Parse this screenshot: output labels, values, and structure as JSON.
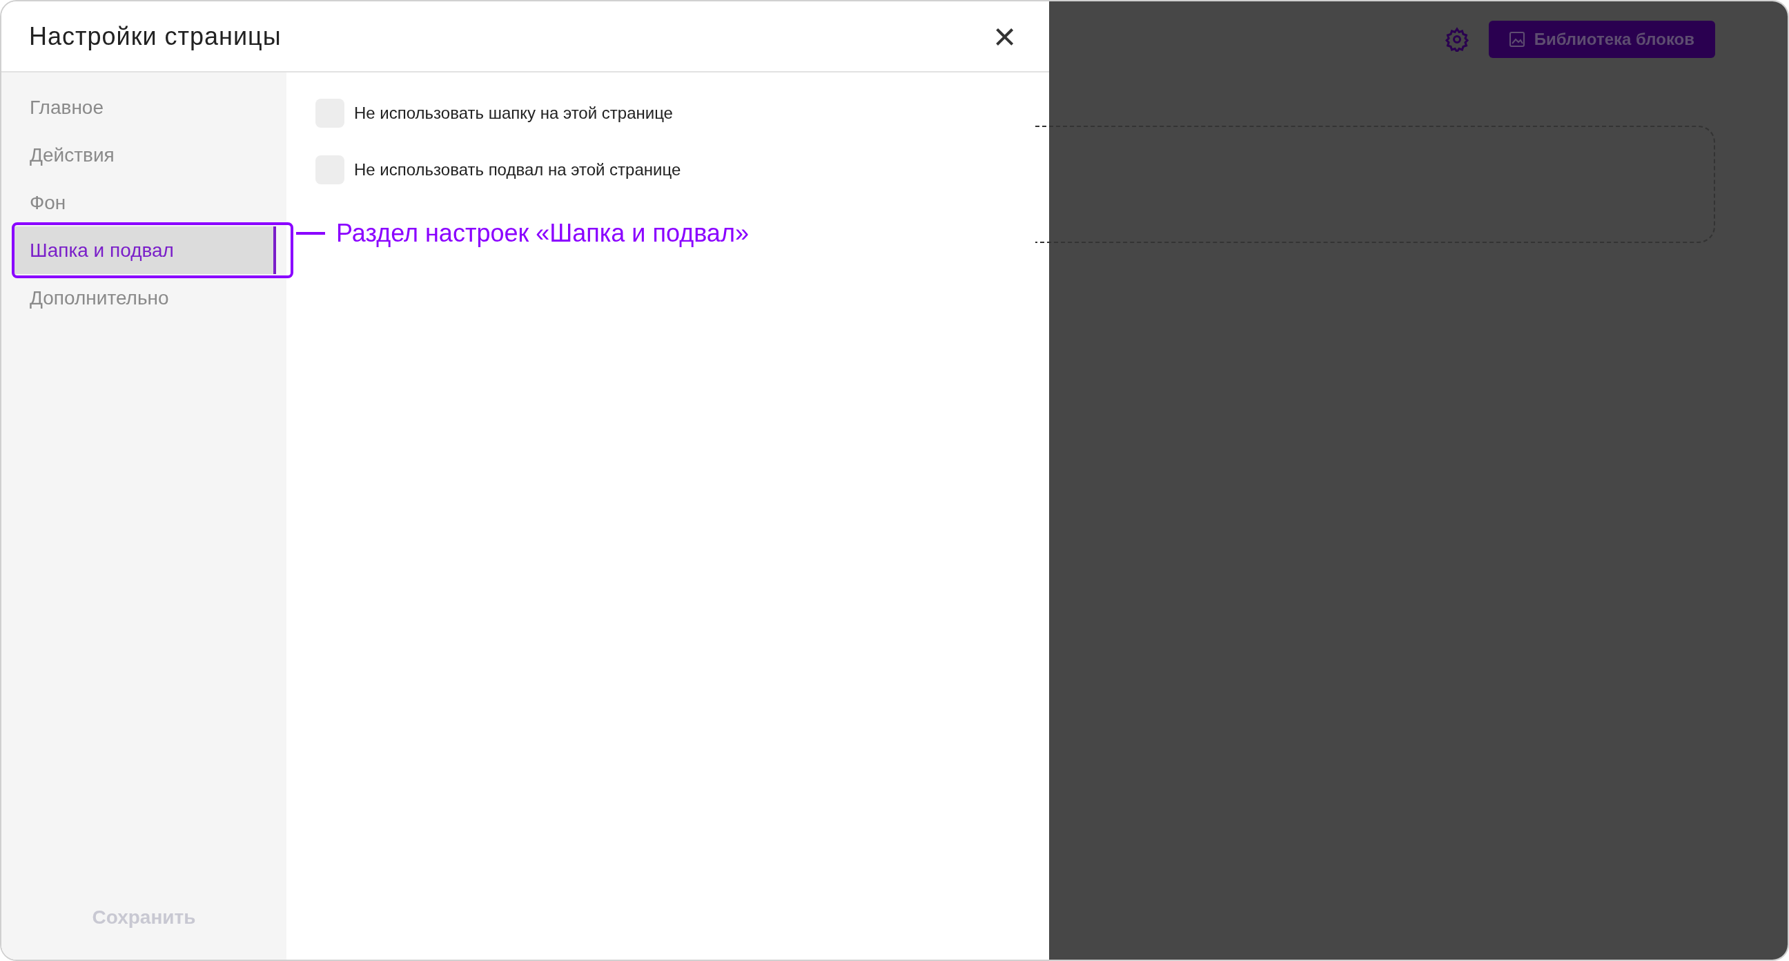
{
  "dialog": {
    "title": "Настройки страницы",
    "close": "×"
  },
  "sidebar": {
    "items": [
      {
        "label": "Главное",
        "selected": false
      },
      {
        "label": "Действия",
        "selected": false
      },
      {
        "label": "Фон",
        "selected": false
      },
      {
        "label": "Шапка и подвал",
        "selected": true
      },
      {
        "label": "Дополнительно",
        "selected": false
      }
    ],
    "save": "Сохранить"
  },
  "options": [
    {
      "label": "Не использовать шапку на этой странице",
      "checked": false
    },
    {
      "label": "Не использовать подвал на этой странице",
      "checked": false
    }
  ],
  "annotation": {
    "text": "Раздел настроек «Шапка и подвал»"
  },
  "background": {
    "library_button": "Библиотека блоков"
  }
}
